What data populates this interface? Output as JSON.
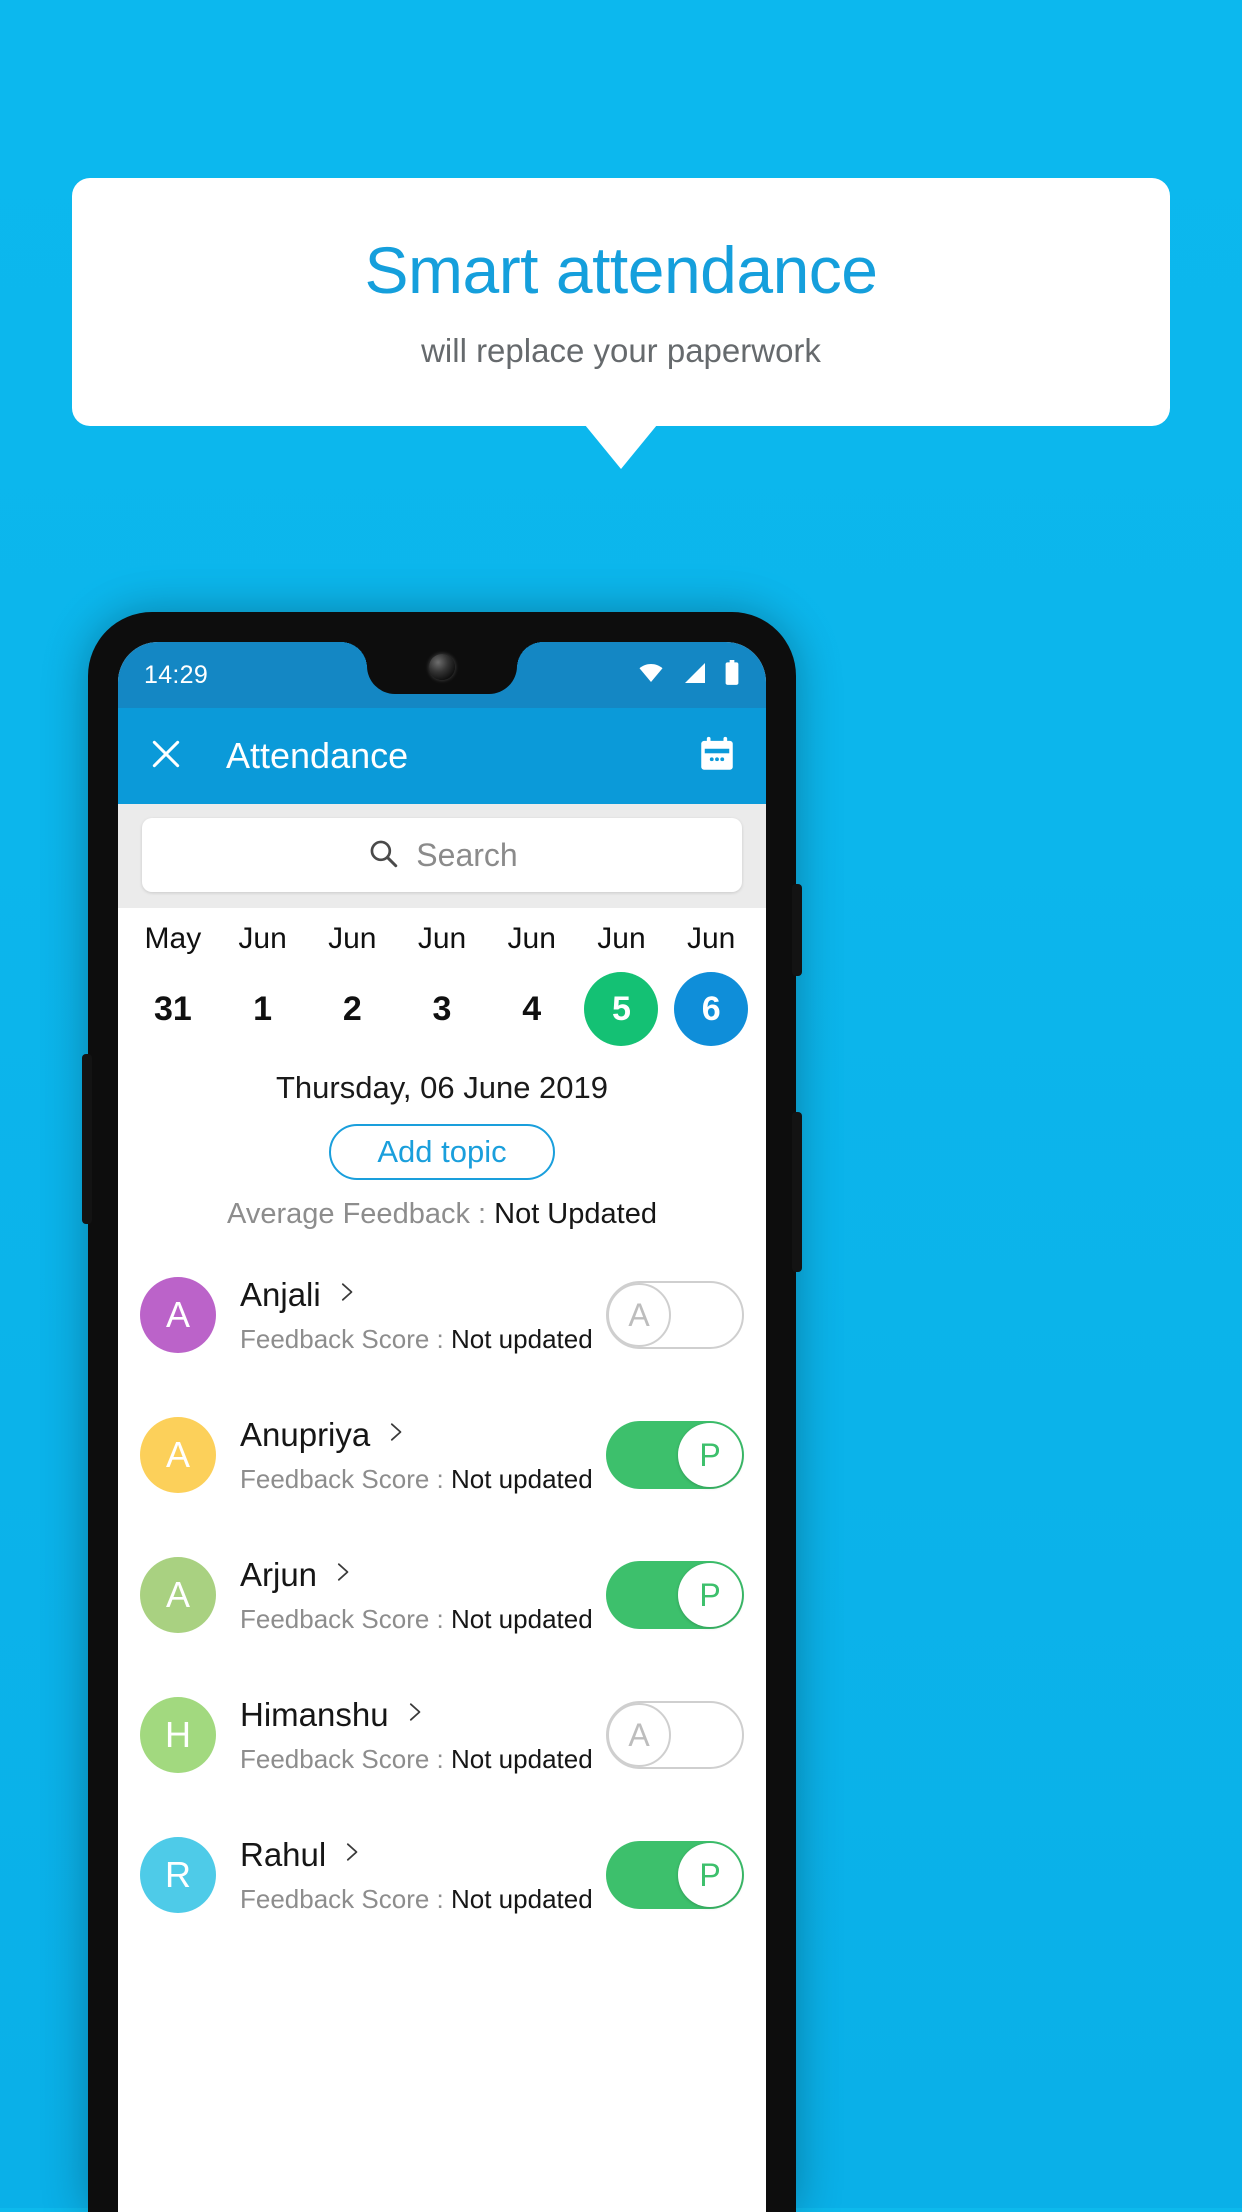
{
  "promo": {
    "title": "Smart attendance",
    "subtitle": "will replace your paperwork"
  },
  "colors": {
    "background": "#0cb8ee",
    "brand_blue": "#0b9ad9",
    "title_blue": "#159fdc",
    "accent_green": "#14c174",
    "toggle_green": "#3dc06c",
    "selected_blue": "#0f8ed9"
  },
  "phone": {
    "statusbar": {
      "clock": "14:29",
      "icons": [
        "wifi-icon",
        "signal-icon",
        "battery-icon"
      ]
    },
    "appbar": {
      "close_icon": "close-icon",
      "title": "Attendance",
      "calendar_icon": "calendar-icon"
    },
    "search": {
      "icon": "search-icon",
      "placeholder": "Search",
      "value": ""
    },
    "date_strip": [
      {
        "month": "May",
        "day": "31",
        "state": "normal"
      },
      {
        "month": "Jun",
        "day": "1",
        "state": "normal"
      },
      {
        "month": "Jun",
        "day": "2",
        "state": "normal"
      },
      {
        "month": "Jun",
        "day": "3",
        "state": "normal"
      },
      {
        "month": "Jun",
        "day": "4",
        "state": "normal"
      },
      {
        "month": "Jun",
        "day": "5",
        "state": "today"
      },
      {
        "month": "Jun",
        "day": "6",
        "state": "selected"
      }
    ],
    "date_info": {
      "full_date": "Thursday, 06 June 2019",
      "add_topic_label": "Add topic",
      "average_feedback_label": "Average Feedback : ",
      "average_feedback_value": "Not Updated"
    },
    "students": [
      {
        "initial": "A",
        "name": "Anjali",
        "avatar_color": "#bb63c9",
        "score_label": "Feedback Score : ",
        "score_value": "Not updated",
        "attendance": "A",
        "present": false
      },
      {
        "initial": "A",
        "name": "Anupriya",
        "avatar_color": "#fcd05a",
        "score_label": "Feedback Score : ",
        "score_value": "Not updated",
        "attendance": "P",
        "present": true
      },
      {
        "initial": "A",
        "name": "Arjun",
        "avatar_color": "#a9d181",
        "score_label": "Feedback Score : ",
        "score_value": "Not updated",
        "attendance": "P",
        "present": true
      },
      {
        "initial": "H",
        "name": "Himanshu",
        "avatar_color": "#a2d97f",
        "score_label": "Feedback Score : ",
        "score_value": "Not updated",
        "attendance": "A",
        "present": false
      },
      {
        "initial": "R",
        "name": "Rahul",
        "avatar_color": "#4ecbe8",
        "score_label": "Feedback Score : ",
        "score_value": "Not updated",
        "attendance": "P",
        "present": true
      }
    ]
  }
}
